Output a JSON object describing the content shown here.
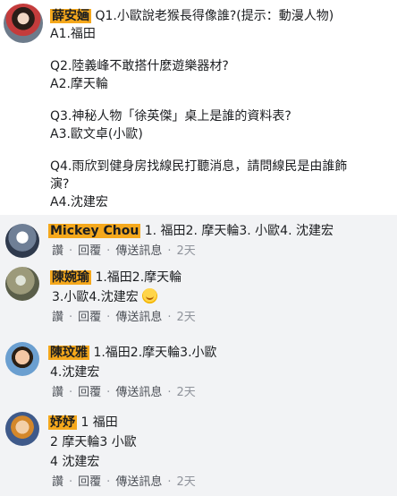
{
  "post": {
    "author": "薛安婳",
    "lines": [
      "Q1.小歐說老猴長得像誰?(提示：動漫人物)",
      "A1.福田",
      "Q2.陸義峰不敢搭什麼遊樂器材?",
      "A2.摩天輪",
      "Q3.神秘人物「徐英傑」桌上是誰的資料表?",
      "A3.歐文卓(小歐)",
      "Q4.雨欣到健身房找線民打聽消息，請問線民是由誰飾",
      "演?",
      "A4.沈建宏"
    ]
  },
  "comments": [
    {
      "author": "Mickey Chou",
      "lines": [
        "1. 福田2. 摩天輪3. 小歐4. 沈建宏"
      ],
      "actions": {
        "like": "讚",
        "reply": "回覆",
        "message": "傳送訊息",
        "time": "2天"
      }
    },
    {
      "author": "陳婉瑜",
      "lines": [
        "1.福田2.摩天輪",
        "3.小歐4.沈建宏"
      ],
      "emoji": "smile-emoji",
      "actions": {
        "like": "讚",
        "reply": "回覆",
        "message": "傳送訊息",
        "time": "2天"
      }
    },
    {
      "author": "陳玟雅",
      "lines": [
        "1.福田2.摩天輪3.小歐",
        "4.沈建宏"
      ],
      "actions": {
        "like": "讚",
        "reply": "回覆",
        "message": "傳送訊息",
        "time": "2天"
      }
    },
    {
      "author": "妤妤",
      "lines": [
        "1 福田",
        "2 摩天輪3 小歐",
        "4 沈建宏"
      ],
      "actions": {
        "like": "讚",
        "reply": "回覆",
        "message": "傳送訊息",
        "time": "2天"
      }
    }
  ],
  "colors": {
    "name_highlight": "#f5a81c",
    "comment_bg": "#f2f3f5",
    "meta_text": "#90949c"
  }
}
